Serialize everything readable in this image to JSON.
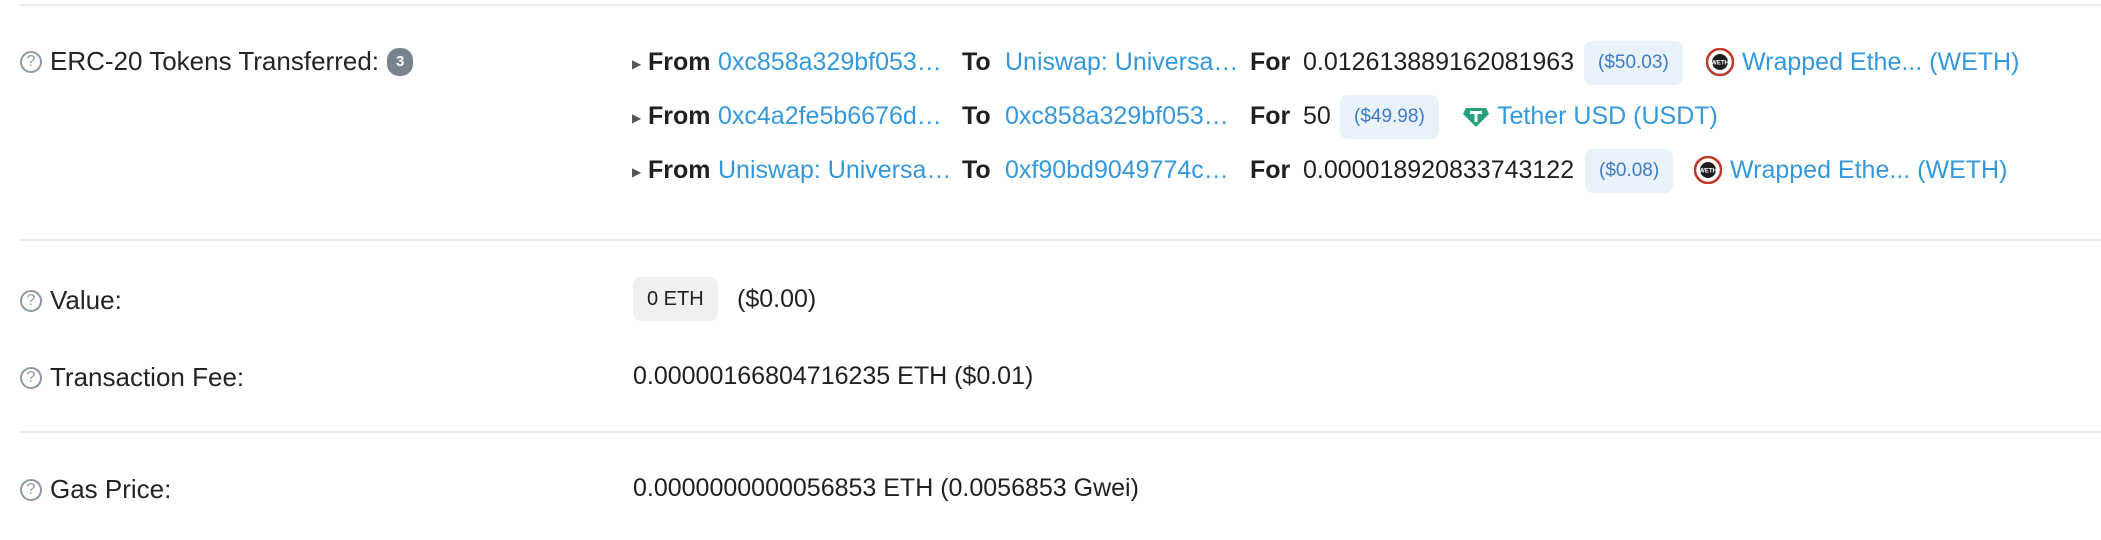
{
  "token_transfers": {
    "label": "ERC-20 Tokens Transferred:",
    "count": "3",
    "rows": [
      {
        "from_label": "From",
        "from": "0xc858a329bf053…",
        "to_label": "To",
        "to": "Uniswap: Universa…",
        "for_label": "For",
        "amount": "0.012613889162081963",
        "usd": "($50.03)",
        "token_name": "Wrapped Ethe... (WETH)",
        "token_icon": "weth-icon"
      },
      {
        "from_label": "From",
        "from": "0xc4a2fe5b6676d…",
        "to_label": "To",
        "to": "0xc858a329bf053…",
        "for_label": "For",
        "amount": "50",
        "usd": "($49.98)",
        "token_name": "Tether USD (USDT)",
        "token_icon": "usdt-icon"
      },
      {
        "from_label": "From",
        "from": "Uniswap: Universa…",
        "to_label": "To",
        "to": "0xf90bd9049774c…",
        "for_label": "For",
        "amount": "0.000018920833743122",
        "usd": "($0.08)",
        "token_name": "Wrapped Ethe... (WETH)",
        "token_icon": "weth-icon"
      }
    ]
  },
  "value": {
    "label": "Value:",
    "eth": "0 ETH",
    "usd": "($0.00)"
  },
  "fee": {
    "label": "Transaction Fee:",
    "text": "0.00000166804716235 ETH ($0.01)"
  },
  "gas": {
    "label": "Gas Price:",
    "text": "0.0000000000056853 ETH (0.0056853 Gwei)"
  },
  "colors": {
    "link": "#3498db",
    "usdt": "#26a17b",
    "weth": "#c0392b"
  }
}
